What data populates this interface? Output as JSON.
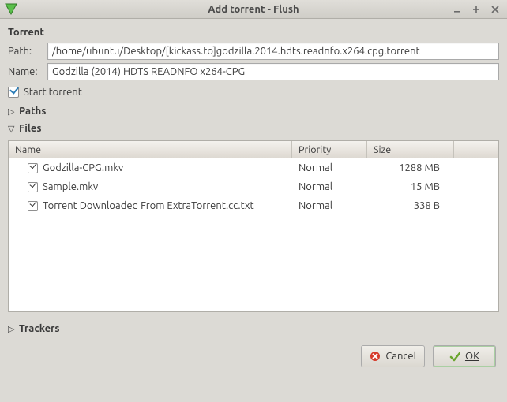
{
  "window": {
    "title": "Add torrent - Flush"
  },
  "torrent": {
    "heading": "Torrent",
    "path_label": "Path:",
    "path_value": "/home/ubuntu/Desktop/[kickass.to]godzilla.2014.hdts.readnfo.x264.cpg.torrent",
    "name_label": "Name:",
    "name_value": "Godzilla (2014) HDTS READNFO x264-CPG",
    "start_torrent_label": "Start torrent",
    "start_torrent_checked": true
  },
  "sections": {
    "paths_label": "Paths",
    "files_label": "Files",
    "trackers_label": "Trackers"
  },
  "files": {
    "columns": {
      "name": "Name",
      "priority": "Priority",
      "size": "Size"
    },
    "rows": [
      {
        "checked": true,
        "name": "Godzilla-CPG.mkv",
        "priority": "Normal",
        "size": "1288 MB"
      },
      {
        "checked": true,
        "name": "Sample.mkv",
        "priority": "Normal",
        "size": "15 MB"
      },
      {
        "checked": true,
        "name": "Torrent Downloaded From ExtraTorrent.cc.txt",
        "priority": "Normal",
        "size": "338 B"
      }
    ]
  },
  "buttons": {
    "cancel": "Cancel",
    "ok": "OK"
  }
}
